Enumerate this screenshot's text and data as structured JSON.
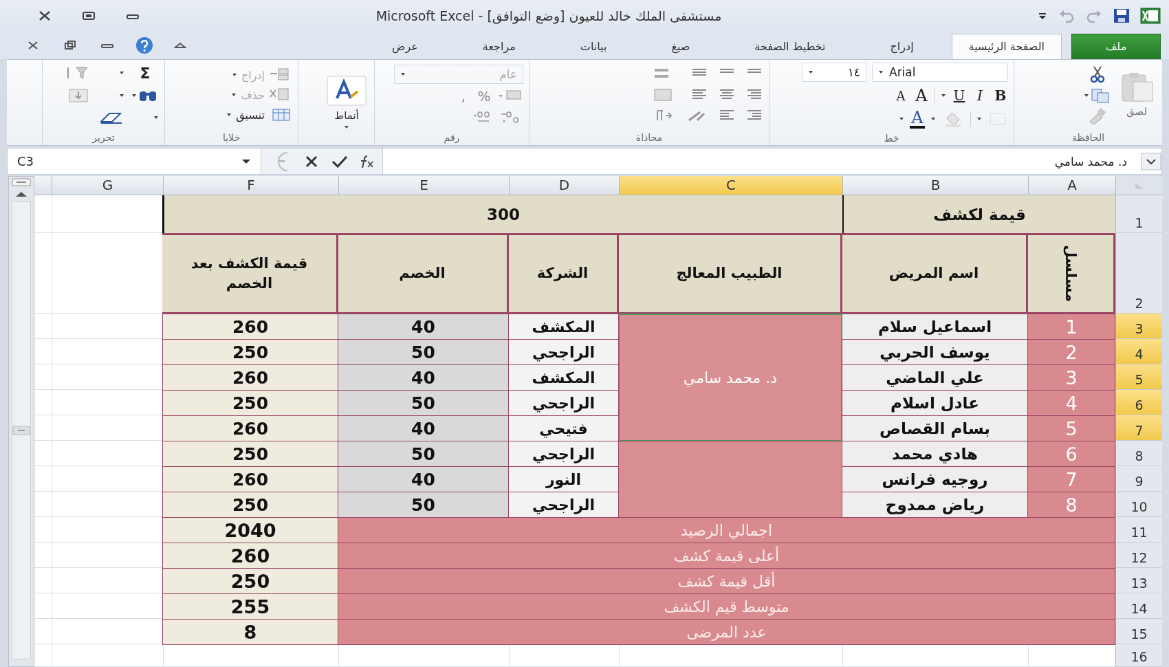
{
  "title_bar": {
    "title": "مستشفى الملك خالد للعيون  [وضع التوافق] - Microsoft Excel"
  },
  "tabs": [
    {
      "label": "ملف",
      "kind": "file",
      "selected": false
    },
    {
      "label": "الصفحة الرئيسية",
      "kind": "tab",
      "selected": true
    },
    {
      "label": "إدراج",
      "kind": "tab",
      "selected": false
    },
    {
      "label": "تخطيط الصفحة",
      "kind": "tab",
      "selected": false
    },
    {
      "label": "صيغ",
      "kind": "tab",
      "selected": false
    },
    {
      "label": "بيانات",
      "kind": "tab",
      "selected": false
    },
    {
      "label": "مراجعة",
      "kind": "tab",
      "selected": false
    },
    {
      "label": "عرض",
      "kind": "tab",
      "selected": false
    }
  ],
  "ribbon": {
    "clipboard": {
      "label": "الحافظة",
      "paste": "لصق"
    },
    "font": {
      "label": "خط",
      "name": "Arial",
      "size": "١٤",
      "styles": [
        "B",
        "I",
        "U"
      ],
      "grow": "A",
      "shrink": "A",
      "color_letter": "A"
    },
    "alignment": {
      "label": "محاذاة"
    },
    "number": {
      "label": "رقم",
      "format": "عام",
      "symbols": [
        "%",
        ","
      ]
    },
    "styles": {
      "button": "أنماط"
    },
    "cells": {
      "label": "خلايا",
      "buttons": [
        "إدراج",
        "حذف",
        "تنسيق"
      ]
    },
    "editing": {
      "label": "تحرير",
      "sum": "Σ"
    }
  },
  "formula_bar": {
    "name_box": "C3",
    "formula": "د. محمد سامي"
  },
  "sheet": {
    "columns": [
      {
        "label": "A",
        "selected": false
      },
      {
        "label": "B",
        "selected": false
      },
      {
        "label": "C",
        "selected": true
      },
      {
        "label": "D",
        "selected": false
      },
      {
        "label": "E",
        "selected": false
      },
      {
        "label": "F",
        "selected": false
      },
      {
        "label": "G",
        "selected": false
      }
    ],
    "rows": [
      {
        "number": "1",
        "selected": false
      },
      {
        "number": "2",
        "selected": false
      },
      {
        "number": "3",
        "selected": true
      },
      {
        "number": "4",
        "selected": true
      },
      {
        "number": "5",
        "selected": true
      },
      {
        "number": "6",
        "selected": true
      },
      {
        "number": "7",
        "selected": true
      },
      {
        "number": "8",
        "selected": false
      },
      {
        "number": "9",
        "selected": false
      },
      {
        "number": "10",
        "selected": false
      },
      {
        "number": "11",
        "selected": false
      },
      {
        "number": "12",
        "selected": false
      },
      {
        "number": "13",
        "selected": false
      },
      {
        "number": "14",
        "selected": false
      },
      {
        "number": "15",
        "selected": false
      },
      {
        "number": "16",
        "selected": false
      }
    ],
    "title_label": "قيمة لكشف",
    "title_value": "300",
    "headers": [
      "مسلسل",
      "اسم المريض",
      "الطبيب المعالج",
      "الشركة",
      "الخصم",
      "قيمة الكشف بعد الخصم"
    ],
    "doctor_groups": [
      {
        "doctor": "د. محمد سامي",
        "selected": true,
        "records": [
          {
            "serial": "1",
            "patient": "اسماعيل سلام",
            "company": "المكشف",
            "discount": "40",
            "net": "260"
          },
          {
            "serial": "2",
            "patient": "يوسف الحربي",
            "company": "الراجحي",
            "discount": "50",
            "net": "250"
          },
          {
            "serial": "3",
            "patient": "علي الماضي",
            "company": "المكشف",
            "discount": "40",
            "net": "260"
          },
          {
            "serial": "4",
            "patient": "عادل اسلام",
            "company": "الراجحي",
            "discount": "50",
            "net": "250"
          },
          {
            "serial": "5",
            "patient": "بسام القصاص",
            "company": "فتيحي",
            "discount": "40",
            "net": "260"
          }
        ]
      },
      {
        "selected": false,
        "records": [
          {
            "serial": "6",
            "patient": "هادي محمد",
            "company": "الراجحي",
            "discount": "50",
            "net": "250"
          },
          {
            "serial": "7",
            "patient": "روجيه فرانس",
            "company": "النور",
            "discount": "40",
            "net": "260"
          },
          {
            "serial": "8",
            "patient": "رياض ممدوح",
            "company": "الراجحي",
            "discount": "50",
            "net": "250"
          }
        ]
      }
    ],
    "summary": [
      {
        "label": "اجمالي الرصيد",
        "value": "2040"
      },
      {
        "label": "أعلى قيمة كشف",
        "value": "260"
      },
      {
        "label": "أقل قيمة كشف",
        "value": "250"
      },
      {
        "label": "متوسط قيم الكشف",
        "value": "255"
      },
      {
        "label": "عدد المرضى",
        "value": "8"
      }
    ]
  }
}
